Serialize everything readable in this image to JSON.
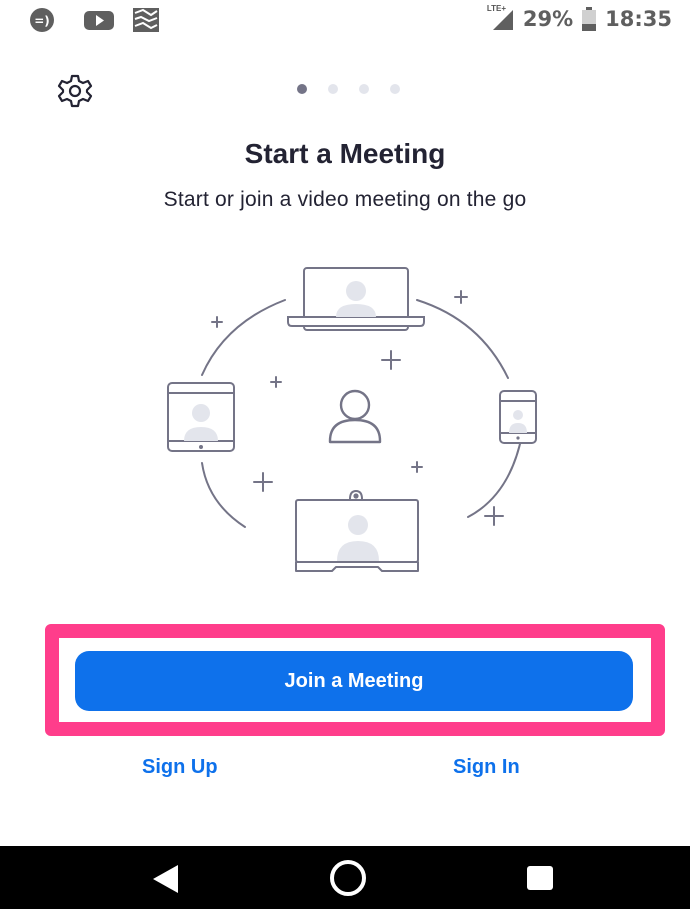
{
  "status_bar": {
    "icons": [
      "messaging-icon",
      "youtube-icon",
      "gallery-icon"
    ],
    "network": "LTE+",
    "battery_percent": "29%",
    "time": "18:35"
  },
  "carousel": {
    "page_count": 4,
    "active_index": 0
  },
  "onboarding": {
    "title": "Start a Meeting",
    "subtitle": "Start or join a video meeting on the go"
  },
  "actions": {
    "join_label": "Join a Meeting",
    "sign_up_label": "Sign Up",
    "sign_in_label": "Sign In"
  },
  "colors": {
    "accent": "#0e71eb",
    "highlight": "#ff3d8b",
    "text": "#232333",
    "illustration_stroke": "#747487"
  }
}
